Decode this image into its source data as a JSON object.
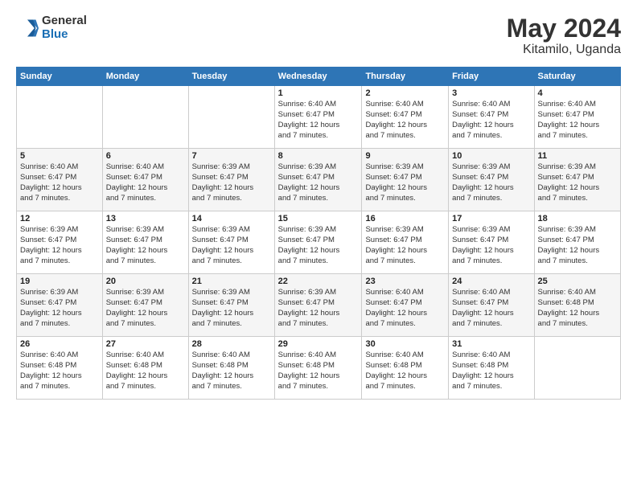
{
  "header": {
    "logo_general": "General",
    "logo_blue": "Blue",
    "main_title": "May 2024",
    "subtitle": "Kitamilo, Uganda"
  },
  "calendar": {
    "days_of_week": [
      "Sunday",
      "Monday",
      "Tuesday",
      "Wednesday",
      "Thursday",
      "Friday",
      "Saturday"
    ],
    "weeks": [
      [
        {
          "day": "",
          "detail": ""
        },
        {
          "day": "",
          "detail": ""
        },
        {
          "day": "",
          "detail": ""
        },
        {
          "day": "1",
          "detail": "Sunrise: 6:40 AM\nSunset: 6:47 PM\nDaylight: 12 hours\nand 7 minutes."
        },
        {
          "day": "2",
          "detail": "Sunrise: 6:40 AM\nSunset: 6:47 PM\nDaylight: 12 hours\nand 7 minutes."
        },
        {
          "day": "3",
          "detail": "Sunrise: 6:40 AM\nSunset: 6:47 PM\nDaylight: 12 hours\nand 7 minutes."
        },
        {
          "day": "4",
          "detail": "Sunrise: 6:40 AM\nSunset: 6:47 PM\nDaylight: 12 hours\nand 7 minutes."
        }
      ],
      [
        {
          "day": "5",
          "detail": "Sunrise: 6:40 AM\nSunset: 6:47 PM\nDaylight: 12 hours\nand 7 minutes."
        },
        {
          "day": "6",
          "detail": "Sunrise: 6:40 AM\nSunset: 6:47 PM\nDaylight: 12 hours\nand 7 minutes."
        },
        {
          "day": "7",
          "detail": "Sunrise: 6:39 AM\nSunset: 6:47 PM\nDaylight: 12 hours\nand 7 minutes."
        },
        {
          "day": "8",
          "detail": "Sunrise: 6:39 AM\nSunset: 6:47 PM\nDaylight: 12 hours\nand 7 minutes."
        },
        {
          "day": "9",
          "detail": "Sunrise: 6:39 AM\nSunset: 6:47 PM\nDaylight: 12 hours\nand 7 minutes."
        },
        {
          "day": "10",
          "detail": "Sunrise: 6:39 AM\nSunset: 6:47 PM\nDaylight: 12 hours\nand 7 minutes."
        },
        {
          "day": "11",
          "detail": "Sunrise: 6:39 AM\nSunset: 6:47 PM\nDaylight: 12 hours\nand 7 minutes."
        }
      ],
      [
        {
          "day": "12",
          "detail": "Sunrise: 6:39 AM\nSunset: 6:47 PM\nDaylight: 12 hours\nand 7 minutes."
        },
        {
          "day": "13",
          "detail": "Sunrise: 6:39 AM\nSunset: 6:47 PM\nDaylight: 12 hours\nand 7 minutes."
        },
        {
          "day": "14",
          "detail": "Sunrise: 6:39 AM\nSunset: 6:47 PM\nDaylight: 12 hours\nand 7 minutes."
        },
        {
          "day": "15",
          "detail": "Sunrise: 6:39 AM\nSunset: 6:47 PM\nDaylight: 12 hours\nand 7 minutes."
        },
        {
          "day": "16",
          "detail": "Sunrise: 6:39 AM\nSunset: 6:47 PM\nDaylight: 12 hours\nand 7 minutes."
        },
        {
          "day": "17",
          "detail": "Sunrise: 6:39 AM\nSunset: 6:47 PM\nDaylight: 12 hours\nand 7 minutes."
        },
        {
          "day": "18",
          "detail": "Sunrise: 6:39 AM\nSunset: 6:47 PM\nDaylight: 12 hours\nand 7 minutes."
        }
      ],
      [
        {
          "day": "19",
          "detail": "Sunrise: 6:39 AM\nSunset: 6:47 PM\nDaylight: 12 hours\nand 7 minutes."
        },
        {
          "day": "20",
          "detail": "Sunrise: 6:39 AM\nSunset: 6:47 PM\nDaylight: 12 hours\nand 7 minutes."
        },
        {
          "day": "21",
          "detail": "Sunrise: 6:39 AM\nSunset: 6:47 PM\nDaylight: 12 hours\nand 7 minutes."
        },
        {
          "day": "22",
          "detail": "Sunrise: 6:39 AM\nSunset: 6:47 PM\nDaylight: 12 hours\nand 7 minutes."
        },
        {
          "day": "23",
          "detail": "Sunrise: 6:40 AM\nSunset: 6:47 PM\nDaylight: 12 hours\nand 7 minutes."
        },
        {
          "day": "24",
          "detail": "Sunrise: 6:40 AM\nSunset: 6:47 PM\nDaylight: 12 hours\nand 7 minutes."
        },
        {
          "day": "25",
          "detail": "Sunrise: 6:40 AM\nSunset: 6:48 PM\nDaylight: 12 hours\nand 7 minutes."
        }
      ],
      [
        {
          "day": "26",
          "detail": "Sunrise: 6:40 AM\nSunset: 6:48 PM\nDaylight: 12 hours\nand 7 minutes."
        },
        {
          "day": "27",
          "detail": "Sunrise: 6:40 AM\nSunset: 6:48 PM\nDaylight: 12 hours\nand 7 minutes."
        },
        {
          "day": "28",
          "detail": "Sunrise: 6:40 AM\nSunset: 6:48 PM\nDaylight: 12 hours\nand 7 minutes."
        },
        {
          "day": "29",
          "detail": "Sunrise: 6:40 AM\nSunset: 6:48 PM\nDaylight: 12 hours\nand 7 minutes."
        },
        {
          "day": "30",
          "detail": "Sunrise: 6:40 AM\nSunset: 6:48 PM\nDaylight: 12 hours\nand 7 minutes."
        },
        {
          "day": "31",
          "detail": "Sunrise: 6:40 AM\nSunset: 6:48 PM\nDaylight: 12 hours\nand 7 minutes."
        },
        {
          "day": "",
          "detail": ""
        }
      ]
    ]
  }
}
